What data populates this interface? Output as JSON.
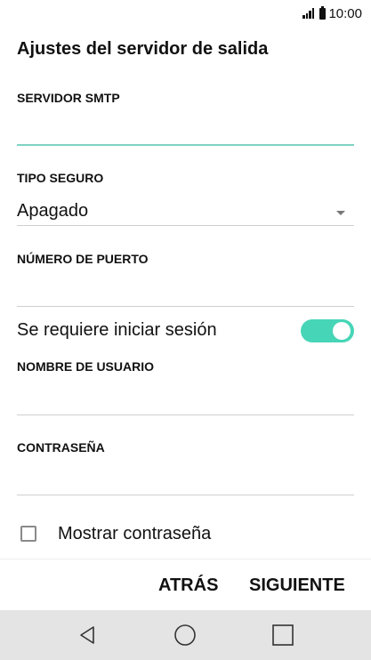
{
  "status_bar": {
    "time": "10:00",
    "signal_icon": "signal-bars-icon",
    "battery_icon": "battery-icon"
  },
  "title": "Ajustes del servidor de salida",
  "fields": {
    "smtp_server": {
      "label": "SERVIDOR SMTP",
      "value": ""
    },
    "security_type": {
      "label": "TIPO SEGURO",
      "value": "Apagado"
    },
    "port": {
      "label": "NÚMERO DE PUERTO",
      "value": ""
    },
    "require_login": {
      "label": "Se requiere iniciar sesión",
      "enabled": true
    },
    "username": {
      "label": "NOMBRE DE USUARIO",
      "value": ""
    },
    "password": {
      "label": "CONTRASEÑA",
      "value": ""
    },
    "show_password": {
      "label": "Mostrar contraseña",
      "checked": false
    }
  },
  "buttons": {
    "back": "ATRÁS",
    "next": "SIGUIENTE"
  },
  "nav_bar": {
    "back_icon": "triangle-back-icon",
    "home_icon": "circle-home-icon",
    "recents_icon": "square-recents-icon"
  },
  "colors": {
    "accent": "#47d5b7",
    "input_active": "#7fd3c4",
    "nav_bg": "#e4e4e4"
  }
}
